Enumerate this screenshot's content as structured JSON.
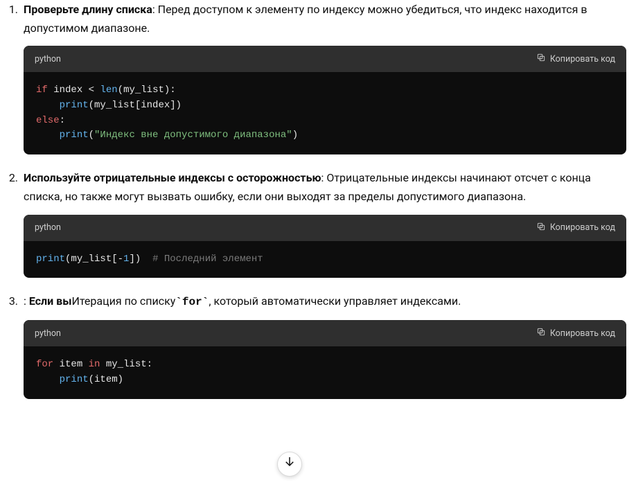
{
  "list": {
    "item1": {
      "bold": "Проверьте длину списка",
      "text_after": ": Перед доступом к элементу по индексу можно убедиться, что индекс находится в допустимом диапазоне."
    },
    "item2": {
      "bold": "Используйте отрицательные индексы с осторожностью",
      "text_after": ": Отрицательные индексы начинают отсчет с конца списка, но также могут вызвать ошибку, если они выходят за пределы допустимого диапазона."
    },
    "item3": {
      "prefix": ": ",
      "bold": "Если вы",
      "mid": "Итерация по списку",
      "code_word": "`for`",
      "text_after": ", который автоматически управляет индексами."
    }
  },
  "code_blocks": {
    "lang_label": "python",
    "copy_label": "Копировать код",
    "block1": {
      "l1": {
        "kw_if": "if",
        "sp1": " ",
        "id_index": "index",
        "sp2": " ",
        "op_lt": "<",
        "sp3": " ",
        "bn_len": "len",
        "lp": "(",
        "id_list": "my_list",
        "rp": ")",
        "colon": ":"
      },
      "l2": {
        "indent": "    ",
        "fn_print": "print",
        "lp": "(",
        "id_list": "my_list",
        "lb": "[",
        "id_index": "index",
        "rb": "]",
        "rp": ")"
      },
      "l3": {
        "kw_else": "else",
        "colon": ":"
      },
      "l4": {
        "indent": "    ",
        "fn_print": "print",
        "lp": "(",
        "str": "\"Индекс вне допустимого диапазона\"",
        "rp": ")"
      }
    },
    "block2": {
      "l1": {
        "fn_print": "print",
        "lp": "(",
        "id_list": "my_list",
        "lb": "[",
        "num_neg1_minus": "-",
        "num_neg1_one": "1",
        "rb": "]",
        "rp": ")",
        "spaces": "  ",
        "comment": "# Последний элемент"
      }
    },
    "block3": {
      "l1": {
        "kw_for": "for",
        "sp1": " ",
        "id_item": "item",
        "sp2": " ",
        "kw_in": "in",
        "sp3": " ",
        "id_list": "my_list",
        "colon": ":"
      },
      "l2": {
        "indent": "    ",
        "fn_print": "print",
        "lp": "(",
        "id_item": "item",
        "rp": ")"
      }
    }
  }
}
